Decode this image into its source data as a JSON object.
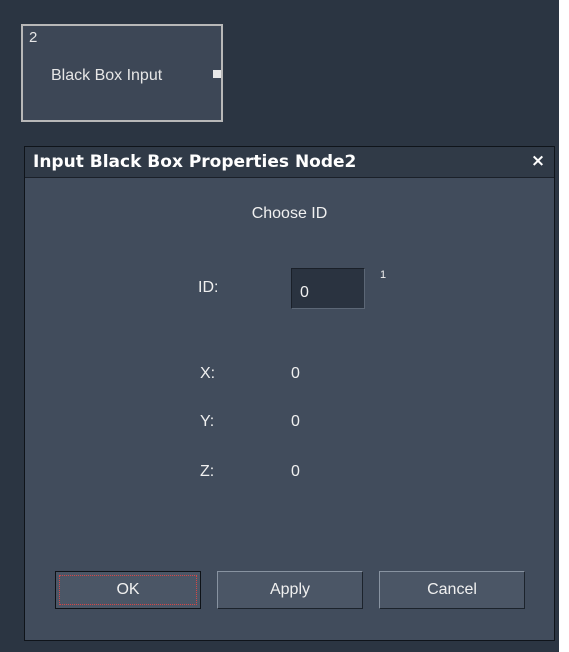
{
  "node": {
    "number": "2",
    "label": "Black Box Input"
  },
  "dialog": {
    "title": "Input Black Box Properties Node2",
    "close_glyph": "×",
    "heading": "Choose ID",
    "id_label": "ID:",
    "id_value": "0",
    "id_superscript": "1",
    "x_label": "X:",
    "x_value": "0",
    "y_label": "Y:",
    "y_value": "0",
    "z_label": "Z:",
    "z_value": "0",
    "buttons": {
      "ok": "OK",
      "apply": "Apply",
      "cancel": "Cancel"
    }
  },
  "colors": {
    "canvas_bg": "#2b3542",
    "dialog_bg": "#414c5c",
    "titlebar_bg": "#303a47",
    "text": "#f0f0f0",
    "focus_rect": "#d64545"
  }
}
